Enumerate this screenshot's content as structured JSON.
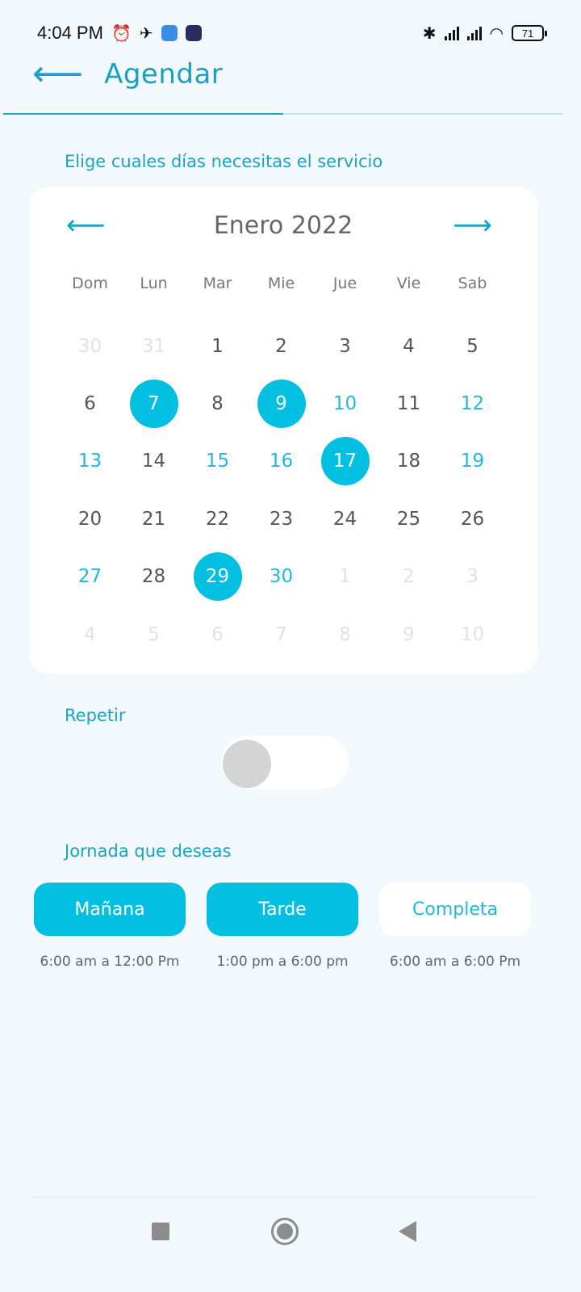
{
  "status_bar": {
    "time": "4:04 PM",
    "battery": "71",
    "icons": [
      "alarm-icon",
      "notification-icon",
      "mail-icon",
      "app-icon",
      "bluetooth-icon",
      "signal-icon",
      "signal-icon",
      "wifi-icon",
      "battery-icon"
    ]
  },
  "header": {
    "title": "Agendar",
    "back_icon": "arrow-left-icon",
    "progress": 0.5
  },
  "days_section": {
    "label": "Elige cuales días necesitas el servicio"
  },
  "calendar": {
    "month_label": "Enero 2022",
    "prev_icon": "arrow-left-icon",
    "next_icon": "arrow-right-icon",
    "weekdays": [
      "Dom",
      "Lun",
      "Mar",
      "Mie",
      "Jue",
      "Vie",
      "Sab"
    ],
    "days": [
      {
        "label": "30",
        "state": "muted"
      },
      {
        "label": "31",
        "state": "muted"
      },
      {
        "label": "1",
        "state": "normal"
      },
      {
        "label": "2",
        "state": "normal"
      },
      {
        "label": "3",
        "state": "normal"
      },
      {
        "label": "4",
        "state": "normal"
      },
      {
        "label": "5",
        "state": "normal"
      },
      {
        "label": "6",
        "state": "normal"
      },
      {
        "label": "7",
        "state": "selected"
      },
      {
        "label": "8",
        "state": "normal"
      },
      {
        "label": "9",
        "state": "selected"
      },
      {
        "label": "10",
        "state": "avail"
      },
      {
        "label": "11",
        "state": "normal"
      },
      {
        "label": "12",
        "state": "avail"
      },
      {
        "label": "13",
        "state": "avail"
      },
      {
        "label": "14",
        "state": "normal"
      },
      {
        "label": "15",
        "state": "avail"
      },
      {
        "label": "16",
        "state": "avail"
      },
      {
        "label": "17",
        "state": "selected"
      },
      {
        "label": "18",
        "state": "normal"
      },
      {
        "label": "19",
        "state": "avail"
      },
      {
        "label": "20",
        "state": "normal"
      },
      {
        "label": "21",
        "state": "normal"
      },
      {
        "label": "22",
        "state": "normal"
      },
      {
        "label": "23",
        "state": "normal"
      },
      {
        "label": "24",
        "state": "normal"
      },
      {
        "label": "25",
        "state": "normal"
      },
      {
        "label": "26",
        "state": "normal"
      },
      {
        "label": "27",
        "state": "avail"
      },
      {
        "label": "28",
        "state": "normal"
      },
      {
        "label": "29",
        "state": "selected"
      },
      {
        "label": "30",
        "state": "avail"
      },
      {
        "label": "1",
        "state": "muted"
      },
      {
        "label": "2",
        "state": "muted"
      },
      {
        "label": "3",
        "state": "muted"
      },
      {
        "label": "4",
        "state": "muted"
      },
      {
        "label": "5",
        "state": "muted"
      },
      {
        "label": "6",
        "state": "muted"
      },
      {
        "label": "7",
        "state": "muted"
      },
      {
        "label": "8",
        "state": "muted"
      },
      {
        "label": "9",
        "state": "muted"
      },
      {
        "label": "10",
        "state": "muted"
      }
    ]
  },
  "repeat": {
    "label": "Repetir",
    "enabled": false
  },
  "shift_section": {
    "label": "Jornada que deseas",
    "options": [
      {
        "label": "Mañana",
        "time": "6:00 am a 12:00 Pm",
        "selected": true
      },
      {
        "label": "Tarde",
        "time": "1:00 pm a 6:00 pm",
        "selected": true
      },
      {
        "label": "Completa",
        "time": "6:00 am a 6:00 Pm",
        "selected": false
      }
    ]
  },
  "nav_bar": {
    "icons": [
      "recent-apps-icon",
      "home-icon",
      "back-icon"
    ]
  },
  "colors": {
    "accent": "#00bfe0",
    "accent_text": "#1aa3c4",
    "background": "#f3f8fc"
  }
}
